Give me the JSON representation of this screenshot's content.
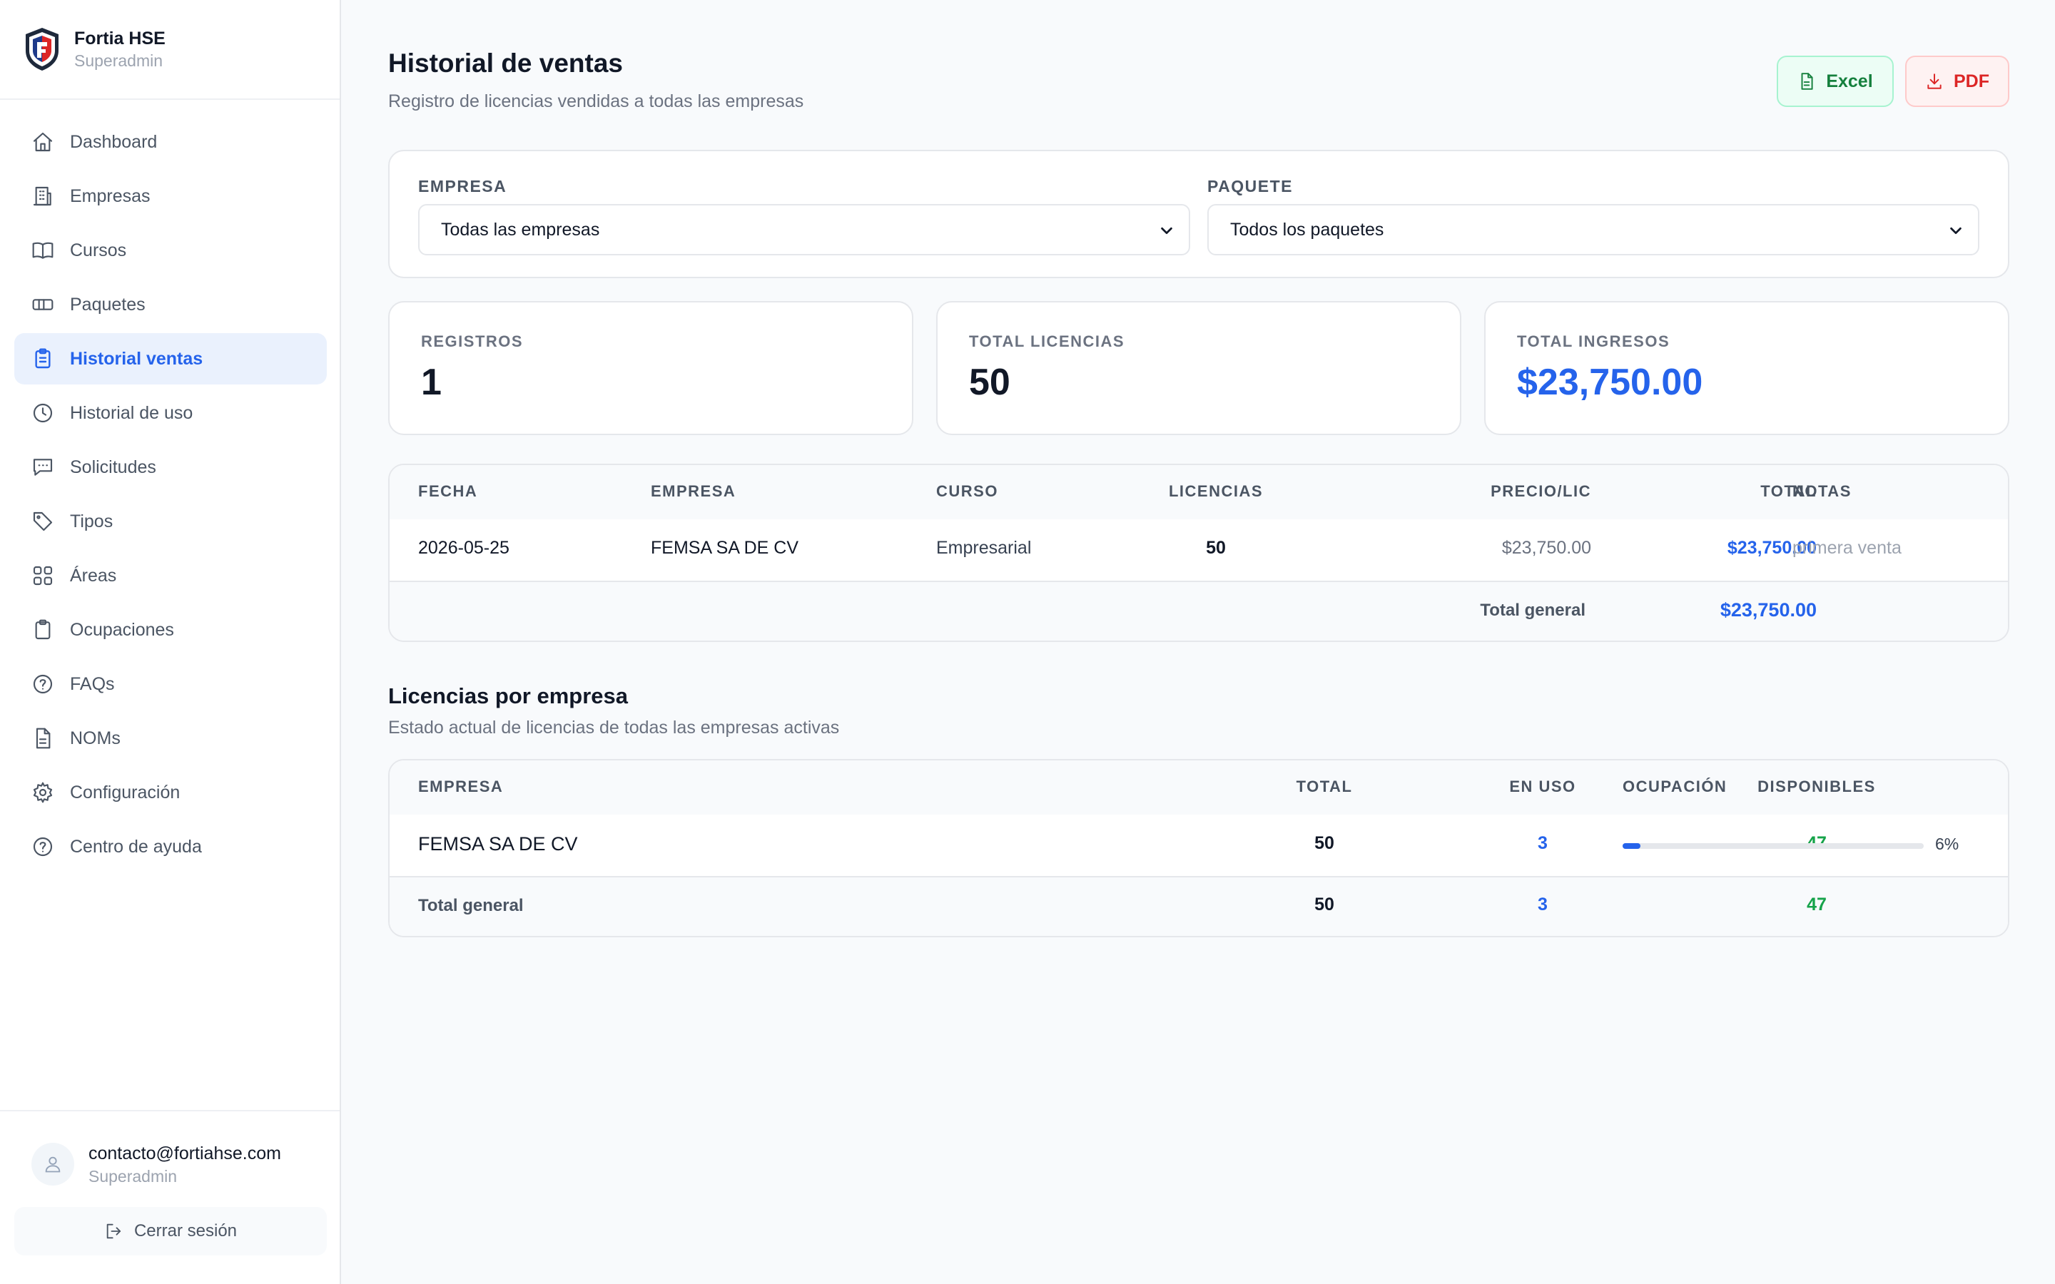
{
  "brand": {
    "name": "Fortia HSE",
    "role": "Superadmin"
  },
  "nav": [
    {
      "label": "Dashboard",
      "icon": "home-icon"
    },
    {
      "label": "Empresas",
      "icon": "building-icon"
    },
    {
      "label": "Cursos",
      "icon": "book-icon"
    },
    {
      "label": "Paquetes",
      "icon": "ticket-icon"
    },
    {
      "label": "Historial ventas",
      "icon": "clipboard-list-icon",
      "active": true
    },
    {
      "label": "Historial de uso",
      "icon": "clock-icon"
    },
    {
      "label": "Solicitudes",
      "icon": "message-icon"
    },
    {
      "label": "Tipos",
      "icon": "tag-icon"
    },
    {
      "label": "Áreas",
      "icon": "grid-icon"
    },
    {
      "label": "Ocupaciones",
      "icon": "clipboard-icon"
    },
    {
      "label": "FAQs",
      "icon": "help-circle-icon"
    },
    {
      "label": "NOMs",
      "icon": "file-text-icon"
    },
    {
      "label": "Configuración",
      "icon": "gear-icon"
    },
    {
      "label": "Centro de ayuda",
      "icon": "help-circle-icon"
    }
  ],
  "user": {
    "email": "contacto@fortiahse.com",
    "role": "Superadmin",
    "logout_label": "Cerrar sesión"
  },
  "header": {
    "title": "Historial de ventas",
    "subtitle": "Registro de licencias vendidas a todas las empresas",
    "excel_label": "Excel",
    "pdf_label": "PDF"
  },
  "filters": {
    "company_label": "EMPRESA",
    "company_value": "Todas las empresas",
    "package_label": "PAQUETE",
    "package_value": "Todos los paquetes"
  },
  "stats": [
    {
      "label": "REGISTROS",
      "value": "1"
    },
    {
      "label": "TOTAL LICENCIAS",
      "value": "50"
    },
    {
      "label": "TOTAL INGRESOS",
      "value": "$23,750.00"
    }
  ],
  "sales_table": {
    "headers": {
      "date": "FECHA",
      "company": "EMPRESA",
      "course": "CURSO",
      "licenses": "LICENCIAS",
      "price": "PRECIO/LIC",
      "total": "TOTAL",
      "notes": "NOTAS"
    },
    "rows": [
      {
        "date": "2026-05-25",
        "company": "FEMSA SA DE CV",
        "course": "Empresarial",
        "licenses": "50",
        "price": "$23,750.00",
        "total": "$23,750.00",
        "notes": "primera venta"
      }
    ],
    "footer_label": "Total general",
    "footer_total": "$23,750.00"
  },
  "licenses_section": {
    "title": "Licencias por empresa",
    "subtitle": "Estado actual de licencias de todas las empresas activas",
    "headers": {
      "company": "EMPRESA",
      "total": "TOTAL",
      "in_use": "EN USO",
      "available": "DISPONIBLES",
      "occupancy": "OCUPACIÓN"
    },
    "rows": [
      {
        "company": "FEMSA SA DE CV",
        "total": "50",
        "in_use": "3",
        "available": "47",
        "occupancy_label": "6%",
        "occupancy_fraction": 0.06
      }
    ],
    "footer": {
      "label": "Total general",
      "total": "50",
      "in_use": "3",
      "available": "47"
    }
  },
  "colors": {
    "accent": "#2563eb",
    "success": "#16a34a",
    "danger": "#dc2626",
    "active_bg": "#eaf1fd"
  }
}
